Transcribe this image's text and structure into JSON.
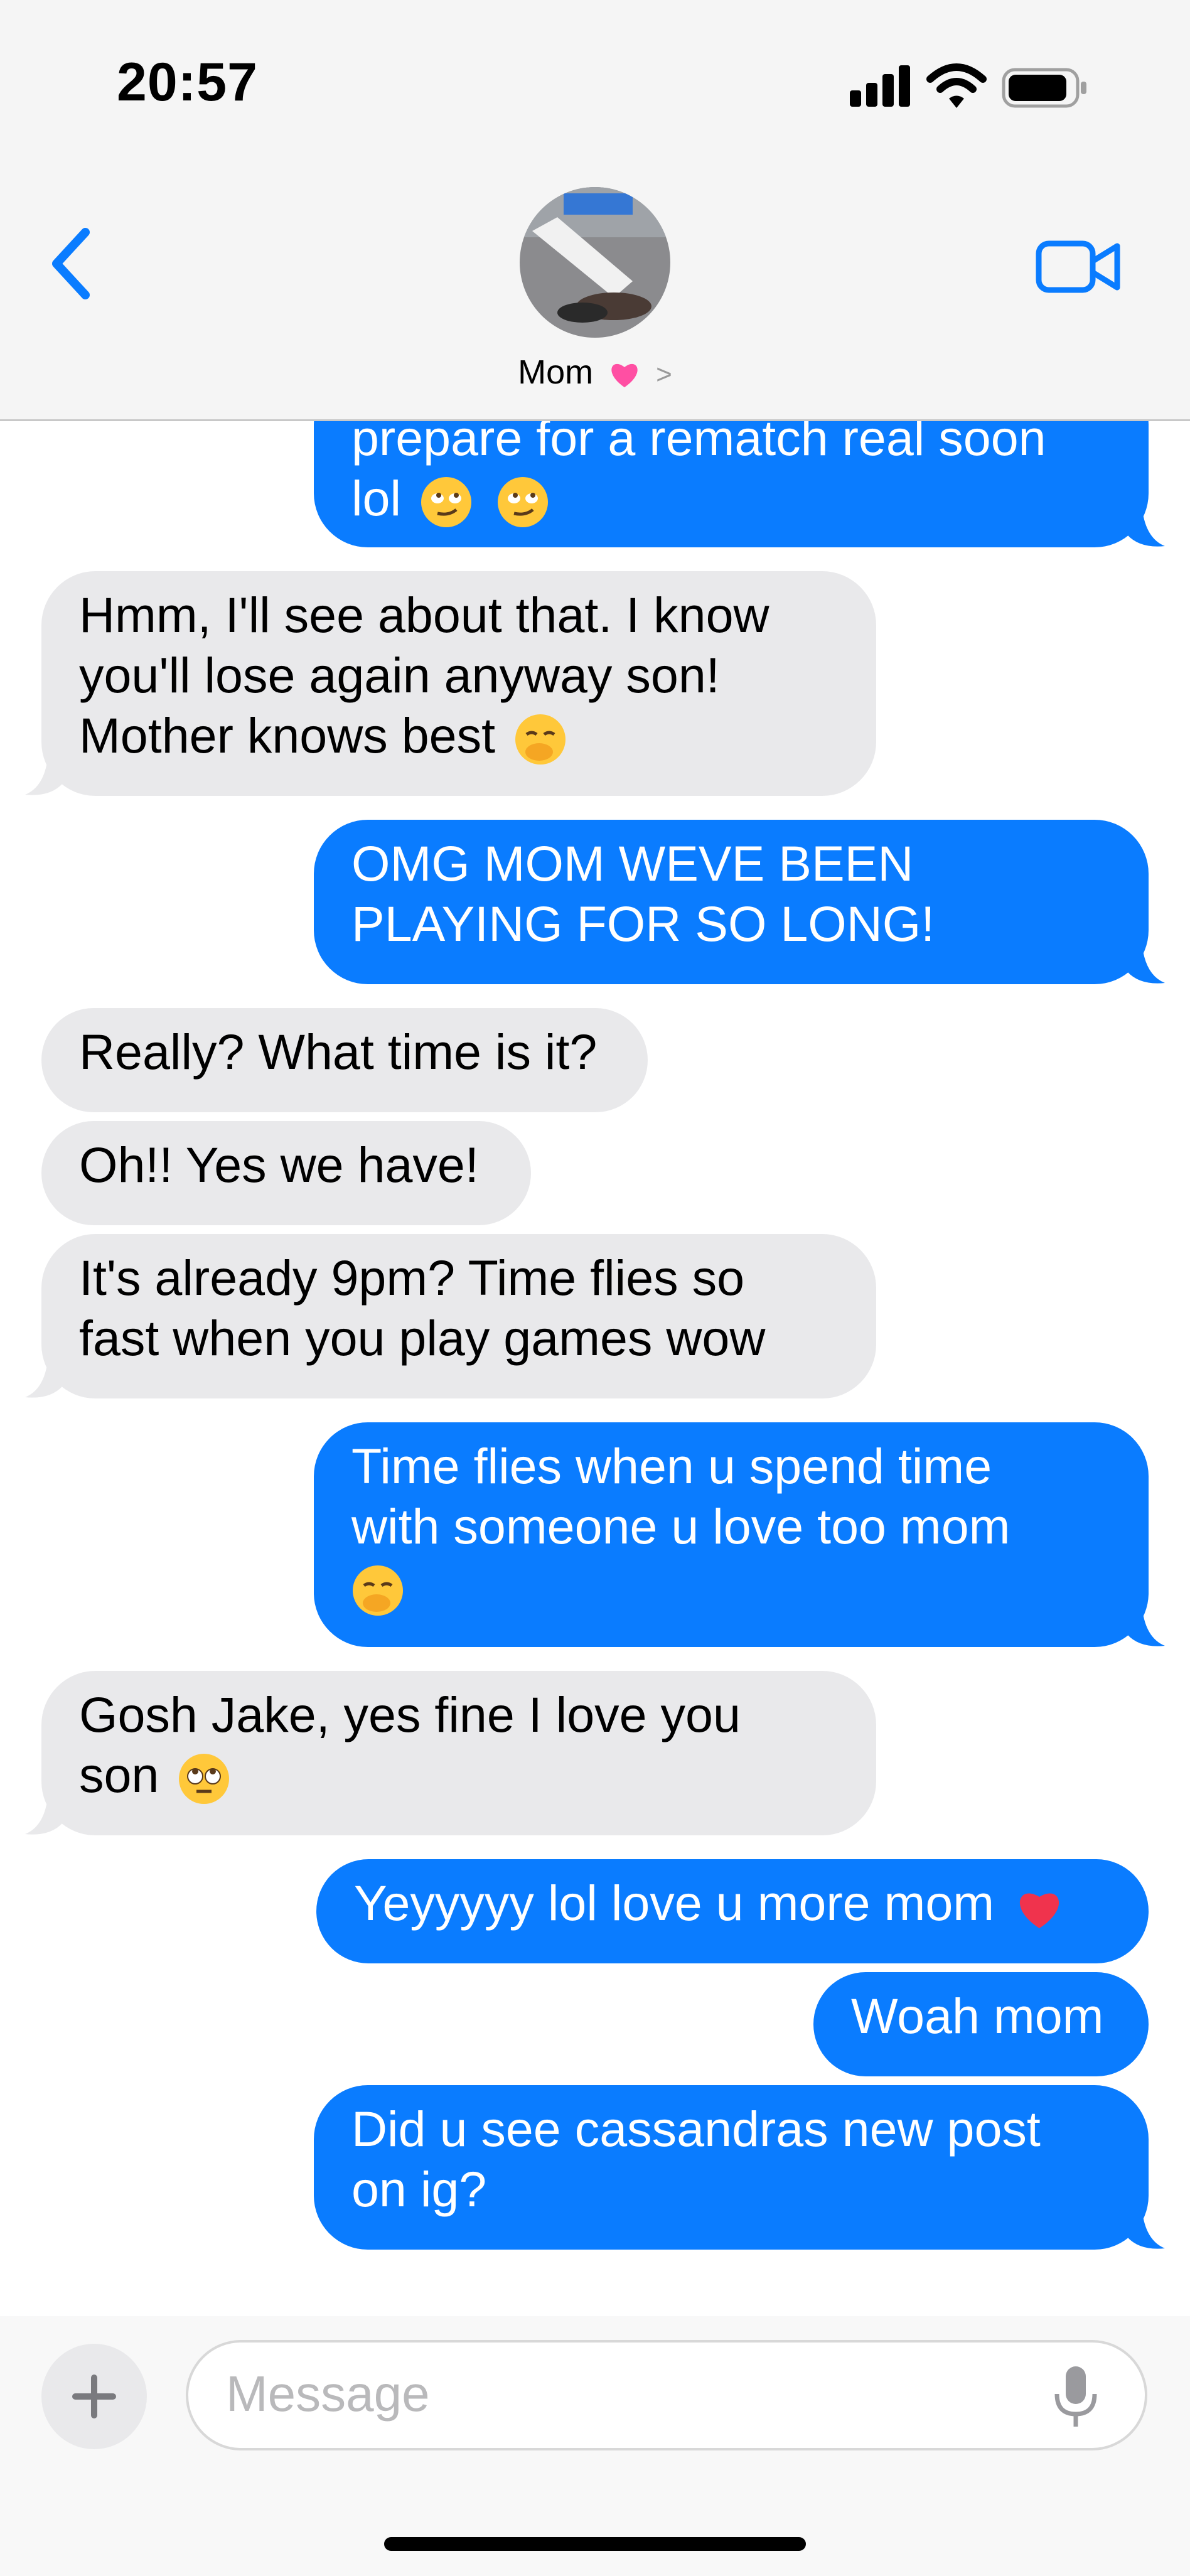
{
  "status_bar": {
    "time": "20:57"
  },
  "header": {
    "contact_name": "Mom",
    "contact_emoji": "heart",
    "chevron": ">"
  },
  "messages": [
    {
      "dir": "sent",
      "lines": [
        "prepare for a rematch real soon",
        "lol"
      ],
      "emoji": [
        "face-with-rolling-eyes-smirk",
        "face-with-rolling-eyes-smirk"
      ]
    },
    {
      "dir": "recv",
      "lines": [
        "Hmm, I'll see about that. I know",
        "you'll lose again anyway son!",
        "Mother knows best"
      ],
      "emoji": [
        "face-with-hand-over-mouth"
      ]
    },
    {
      "dir": "sent",
      "lines": [
        "OMG MOM WEVE BEEN",
        "PLAYING FOR SO LONG!"
      ]
    },
    {
      "dir": "recv",
      "lines": [
        "Really? What time is it?"
      ]
    },
    {
      "dir": "recv",
      "lines": [
        "Oh!! Yes we have!"
      ]
    },
    {
      "dir": "recv",
      "lines": [
        "It's already 9pm? Time flies so",
        "fast when you play games wow"
      ]
    },
    {
      "dir": "sent",
      "lines": [
        "Time flies when u spend time",
        "with someone u love too mom"
      ],
      "emoji": [
        "face-with-hand-over-mouth"
      ]
    },
    {
      "dir": "recv",
      "lines": [
        "Gosh Jake, yes fine I love you",
        "son"
      ],
      "emoji": [
        "face-with-rolling-eyes"
      ]
    },
    {
      "dir": "sent",
      "lines": [
        "Yeyyyyy lol love u more mom"
      ],
      "emoji": [
        "red-heart"
      ]
    },
    {
      "dir": "sent",
      "lines": [
        "Woah mom"
      ]
    },
    {
      "dir": "sent",
      "lines": [
        "Did u see cassandras new post",
        "on ig?"
      ]
    }
  ],
  "input": {
    "placeholder": "Message"
  },
  "colors": {
    "sent_bubble": "#0a7cff",
    "recv_bubble": "#e9e9eb",
    "accent": "#0a7cff",
    "heart": "#ff4fa3"
  }
}
